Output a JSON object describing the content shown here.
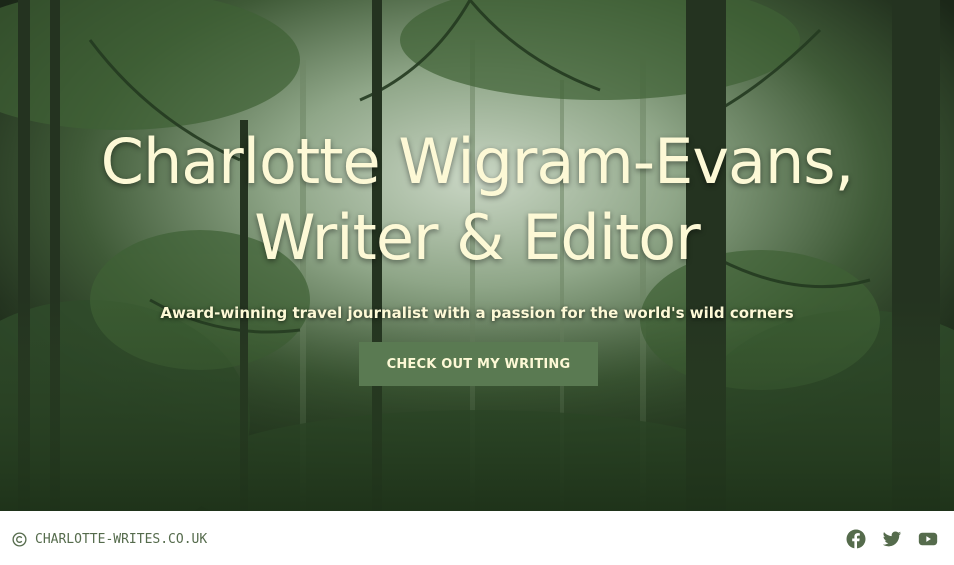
{
  "hero": {
    "title_line1": "Charlotte Wigram-Evans,",
    "title_line2": "Writer & Editor",
    "subtitle": "Award-winning travel journalist with a passion for the world's wild corners",
    "cta_label": "CHECK OUT MY WRITING",
    "background_image": "jungle-rainforest-photo"
  },
  "footer": {
    "copyright_icon": "copyright-icon",
    "site_name": "CHARLOTTE-WRITES.CO.UK",
    "social": [
      {
        "name": "facebook-icon"
      },
      {
        "name": "twitter-icon"
      },
      {
        "name": "youtube-icon"
      }
    ]
  },
  "colors": {
    "accent": "#5a7a52",
    "title_text": "#fdf9d6",
    "footer_text": "#556b4c",
    "footer_bg": "#ffffff"
  }
}
